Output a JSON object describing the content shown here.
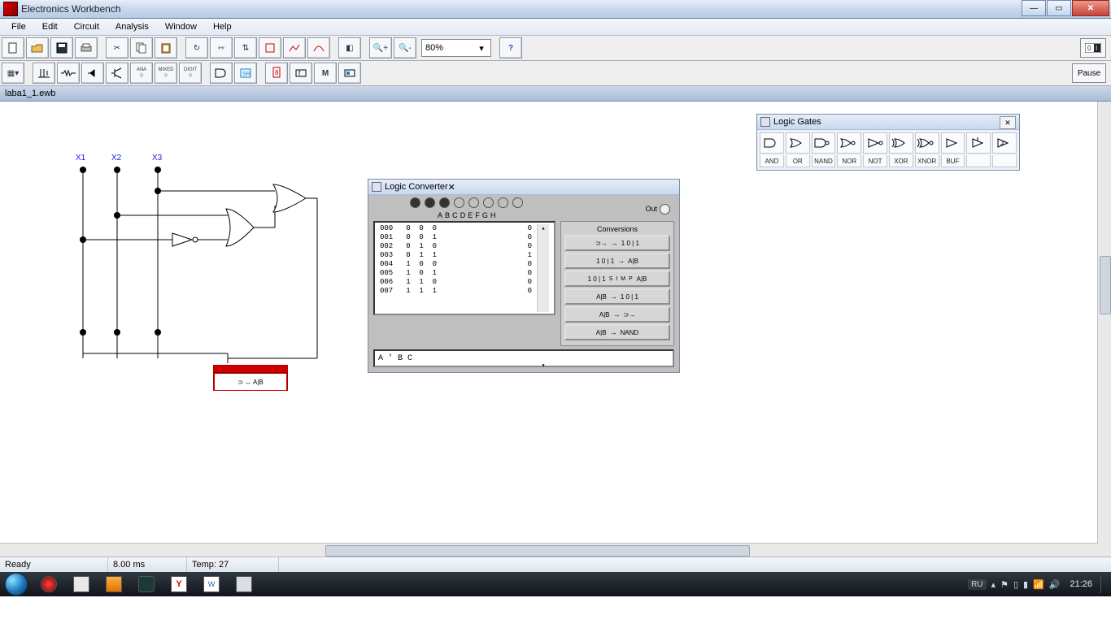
{
  "app": {
    "title": "Electronics Workbench"
  },
  "menubar": [
    "File",
    "Edit",
    "Circuit",
    "Analysis",
    "Window",
    "Help"
  ],
  "toolbar1_zoom": "80%",
  "pause_label": "Pause",
  "doc_tab": "laba1_1.ewb",
  "circuit": {
    "labels": [
      "X1",
      "X2",
      "X3"
    ]
  },
  "logic_gates_palette": {
    "title": "Logic Gates",
    "labels": [
      "AND",
      "OR",
      "NAND",
      "NOR",
      "NOT",
      "XOR",
      "XNOR",
      "BUF"
    ]
  },
  "logic_converter": {
    "title": "Logic Converter",
    "out_label": "Out",
    "vars": [
      "A",
      "B",
      "C",
      "D",
      "E",
      "F",
      "G",
      "H"
    ],
    "active_vars": 3,
    "truth_table": {
      "idx": [
        "000",
        "001",
        "002",
        "003",
        "004",
        "005",
        "006",
        "007"
      ],
      "inputs": [
        "0  0  0",
        "0  0  1",
        "0  1  0",
        "0  1  1",
        "1  0  0",
        "1  0  1",
        "1  1  0",
        "1  1  1"
      ],
      "outputs": [
        "0",
        "0",
        "0",
        "1",
        "0",
        "0",
        "0",
        "0"
      ]
    },
    "conversions_label": "Conversions",
    "buttons": [
      {
        "l": "⊃→",
        "m": "→",
        "r": "1 0 | 1"
      },
      {
        "l": "1 0 | 1",
        "m": "→",
        "r": "A|B"
      },
      {
        "l": "1 0 | 1",
        "m": "S I M P",
        "r": "A|B"
      },
      {
        "l": "A|B",
        "m": "→",
        "r": "1 0 | 1"
      },
      {
        "l": "A|B",
        "m": "→",
        "r": "⊃→"
      },
      {
        "l": "A|B",
        "m": "→",
        "r": "NAND"
      }
    ],
    "expression": "A ' B C"
  },
  "red_component_label": "⊃ ↔ A|B",
  "statusbar": {
    "ready": "Ready",
    "time": "8.00 ms",
    "temp": "Temp: 27"
  },
  "taskbar": {
    "lang": "RU",
    "clock": "21:26"
  }
}
